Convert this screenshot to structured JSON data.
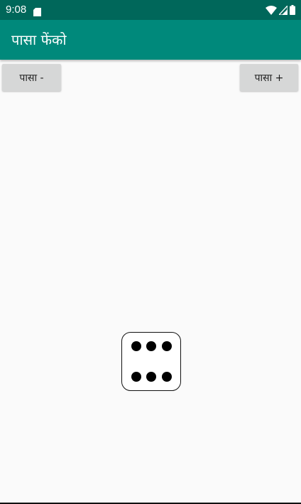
{
  "status_bar": {
    "time": "9:08",
    "background": "#00675a",
    "icons": [
      "sd-card-icon",
      "wifi-icon",
      "cell-signal-icon",
      "battery-icon"
    ]
  },
  "app_bar": {
    "title": "पासा फेंको",
    "background": "#00897b"
  },
  "controls": {
    "decrease_label": "पासा -",
    "increase_label": "पासा +"
  },
  "die": {
    "value": 6,
    "face_color": "#ffffff",
    "pip_color": "#000000"
  }
}
